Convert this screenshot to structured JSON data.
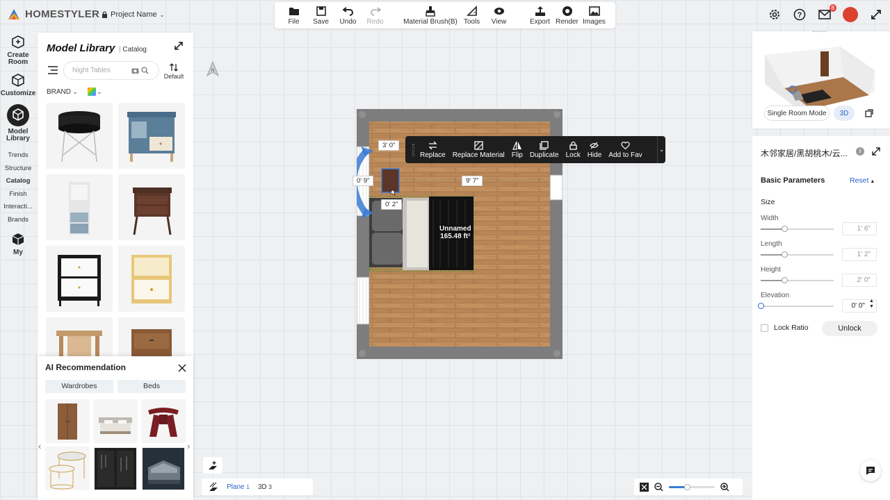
{
  "app": {
    "name": "HOMESTYLER",
    "project_name": "Project Name"
  },
  "toolbar": {
    "file": "File",
    "save": "Save",
    "undo": "Undo",
    "redo": "Redo",
    "material_brush": "Material Brush(B)",
    "tools": "Tools",
    "view": "View",
    "export": "Export",
    "render": "Render",
    "images": "Images"
  },
  "notifications": {
    "count": "8"
  },
  "rail": {
    "create_room": "Create Room",
    "customize": "Customize",
    "model_library": "Model Library",
    "links": [
      "Trends",
      "Structure",
      "Catalog",
      "Finish",
      "Interacti...",
      "Brands"
    ],
    "my": "My"
  },
  "library": {
    "title": "Model Library",
    "subtitle": "Catalog",
    "search_placeholder": "Night Tables",
    "sort_label": "Default",
    "brand_filter": "BRAND",
    "items": [
      "round-side-table",
      "blue-nightstand",
      "tall-nightstand",
      "walnut-nightstand",
      "black-white-nightstand",
      "yellow-nightstand",
      "wood-side-table",
      "wood-cabinet"
    ]
  },
  "ai": {
    "title": "AI Recommendation",
    "tabs": [
      "Wardrobes",
      "Beds"
    ],
    "items": [
      "wardrobe",
      "bed-gray",
      "red-stool",
      "nesting-tables",
      "dark-wardrobe",
      "gray-bed"
    ]
  },
  "canvas": {
    "dimensions": {
      "top": "3' 0\"",
      "left": "0' 9\"",
      "right": "9' 7\"",
      "bottom": "0' 2\""
    },
    "room": {
      "name": "Unnamed",
      "area": "165.48 ft²"
    }
  },
  "context_menu": {
    "replace": "Replace",
    "replace_material": "Replace Material",
    "flip": "Flip",
    "duplicate": "Duplicate",
    "lock": "Lock",
    "hide": "Hide",
    "add_to_fav": "Add to Fav"
  },
  "bottom": {
    "plane_label": "Plane",
    "plane_count": "1",
    "view_3d": "3D",
    "view_3d_count": "3"
  },
  "zoom": {
    "level": 0.4
  },
  "preview": {
    "single_room_mode": "Single Room Mode",
    "mode_3d": "3D"
  },
  "props": {
    "title": "木邻家居/黑胡桃木/云...",
    "section": "Basic Parameters",
    "reset": "Reset",
    "size_label": "Size",
    "params": [
      {
        "label": "Width",
        "value": "1' 6\"",
        "level": 0.32
      },
      {
        "label": "Length",
        "value": "1' 2\"",
        "level": 0.32
      },
      {
        "label": "Height",
        "value": "2' 0\"",
        "level": 0.32
      },
      {
        "label": "Elevation",
        "value": "0' 0\"",
        "level": 0.0
      }
    ],
    "lock_ratio": "Lock Ratio",
    "unlock": "Unlock"
  },
  "colors": {
    "accent": "#2a62c9",
    "wall": "#7d7d7d",
    "floor": "#b07a4d",
    "selection": "#3a7bd5"
  }
}
